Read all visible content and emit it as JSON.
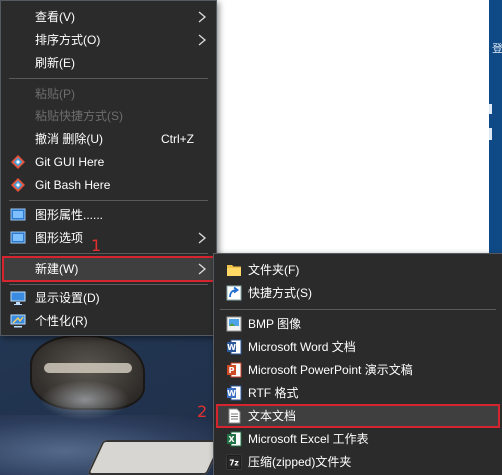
{
  "context_menu": {
    "items": [
      {
        "label": "查看(V)"
      },
      {
        "label": "排序方式(O)"
      },
      {
        "label": "刷新(E)"
      },
      {
        "label": "粘贴(P)"
      },
      {
        "label": "粘贴快捷方式(S)"
      },
      {
        "label": "撤消 删除(U)",
        "shortcut": "Ctrl+Z"
      },
      {
        "label": "Git GUI Here"
      },
      {
        "label": "Git Bash Here"
      },
      {
        "label": "图形属性......"
      },
      {
        "label": "图形选项"
      },
      {
        "label": "新建(W)"
      },
      {
        "label": "显示设置(D)"
      },
      {
        "label": "个性化(R)"
      }
    ]
  },
  "new_submenu": {
    "items": [
      {
        "label": "文件夹(F)"
      },
      {
        "label": "快捷方式(S)"
      },
      {
        "label": "BMP 图像"
      },
      {
        "label": "Microsoft Word 文档"
      },
      {
        "label": "Microsoft PowerPoint 演示文稿"
      },
      {
        "label": "RTF 格式"
      },
      {
        "label": "文本文档"
      },
      {
        "label": "Microsoft Excel 工作表"
      },
      {
        "label": "压缩(zipped)文件夹"
      }
    ]
  },
  "annotations": {
    "step1": "1",
    "step2": "2"
  },
  "background_window": {
    "partial_text": "登"
  },
  "colors": {
    "menu_bg": "#2b2b2b",
    "menu_text": "#ffffff",
    "disabled_text": "#6d6d6d",
    "highlight_border": "#d6252e",
    "annotation": "#e03030"
  }
}
